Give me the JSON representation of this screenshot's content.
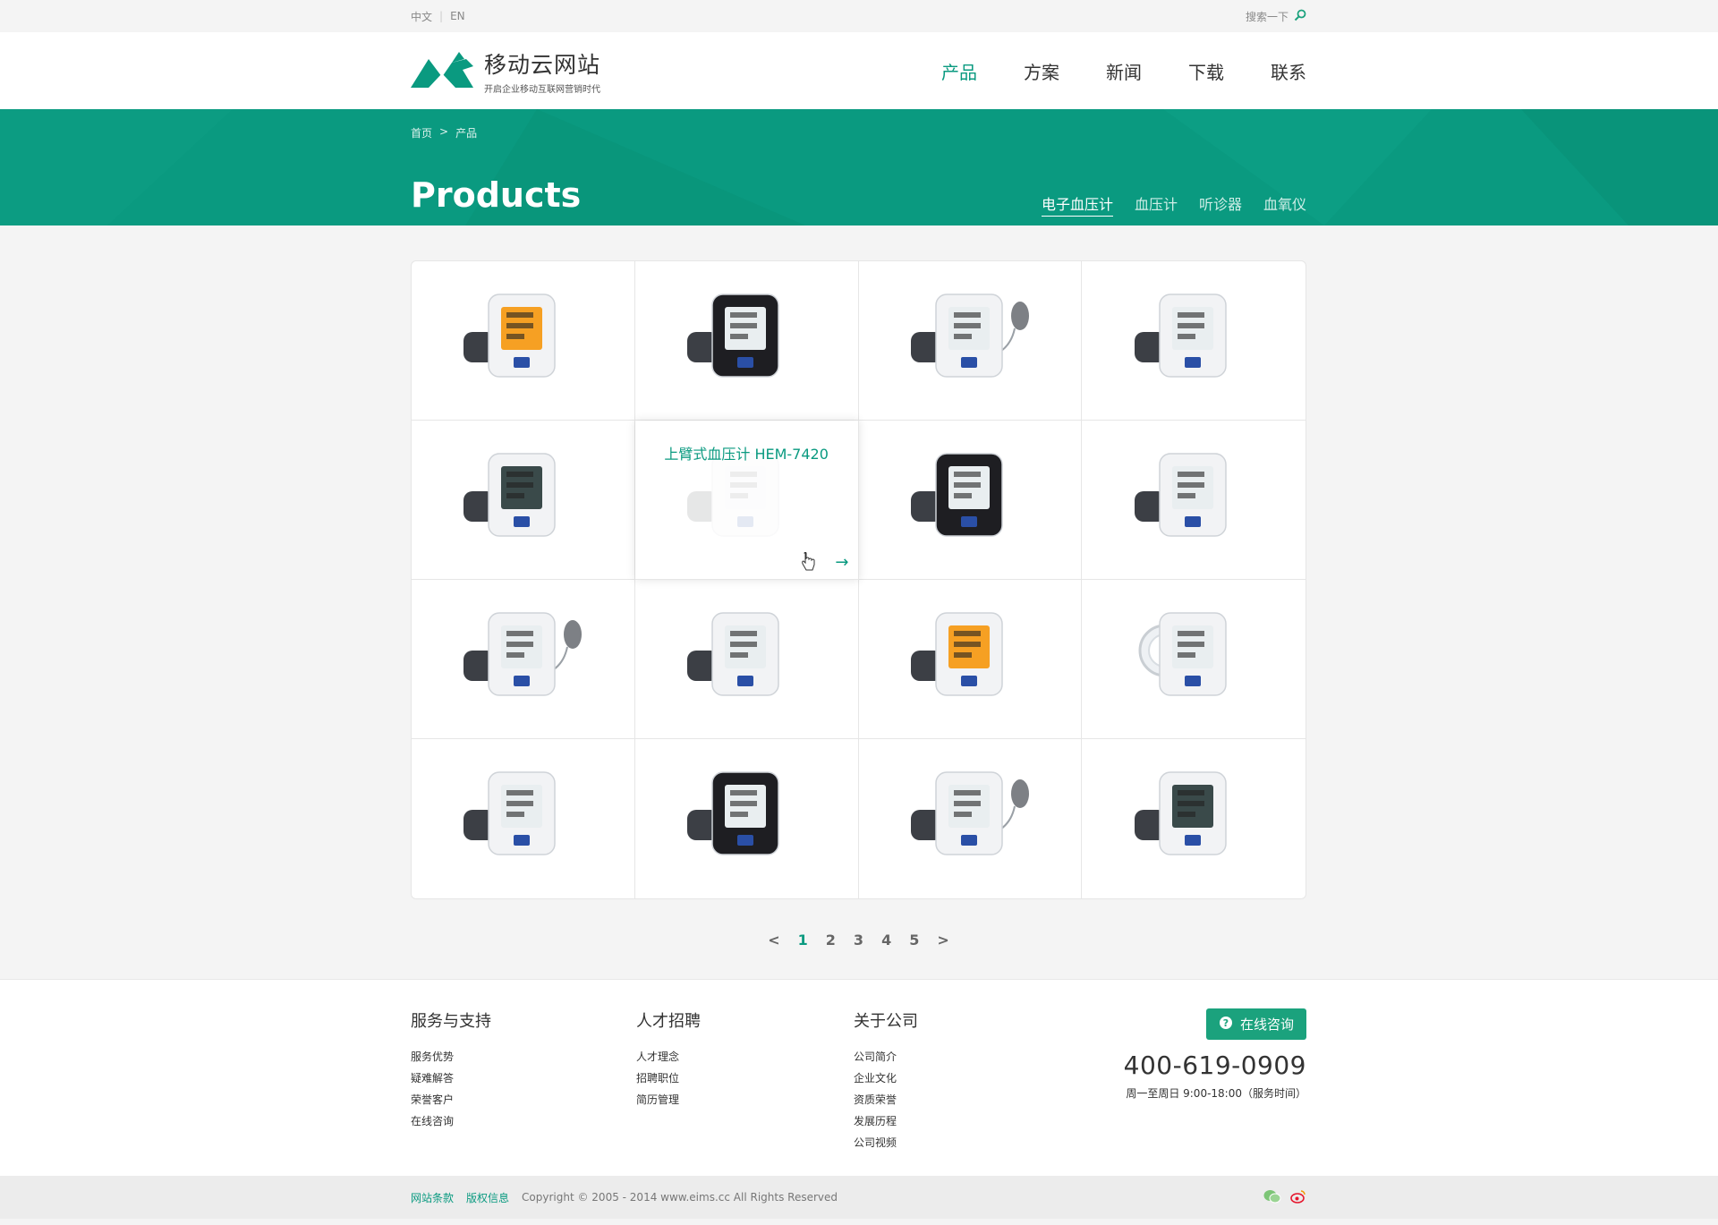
{
  "topbar": {
    "lang_cn": "中文",
    "lang_sep": "|",
    "lang_en": "EN",
    "search_label": "搜索一下"
  },
  "header": {
    "logo_name": "移动云网站",
    "logo_slogan": "开启企业移动互联网营销时代",
    "nav": [
      "产品",
      "方案",
      "新闻",
      "下载",
      "联系"
    ],
    "nav_active": 0,
    "accent_color": "#0a9a80"
  },
  "banner": {
    "breadcrumb": [
      "首页",
      ">",
      "产品"
    ],
    "title": "Products",
    "subnav": [
      "电子血压计",
      "血压计",
      "听诊器",
      "血氧仪"
    ],
    "subnav_active": 0
  },
  "products": {
    "hover_index": 5,
    "hover_title": "上臂式血压计 HEM-7420",
    "hover_arrow": "→",
    "items": [
      {
        "screen": "orange",
        "style": "white"
      },
      {
        "screen": "white",
        "style": "black"
      },
      {
        "screen": "white",
        "style": "bulb"
      },
      {
        "screen": "white",
        "style": "white"
      },
      {
        "screen": "dark",
        "style": "white"
      },
      {
        "screen": "white",
        "style": "white"
      },
      {
        "screen": "white",
        "style": "black"
      },
      {
        "screen": "white",
        "style": "white"
      },
      {
        "screen": "white",
        "style": "bulb"
      },
      {
        "screen": "white",
        "style": "white"
      },
      {
        "screen": "orange",
        "style": "white"
      },
      {
        "screen": "white",
        "style": "arm"
      },
      {
        "screen": "white",
        "style": "white"
      },
      {
        "screen": "white",
        "style": "black"
      },
      {
        "screen": "white",
        "style": "bulb"
      },
      {
        "screen": "dark",
        "style": "white"
      }
    ]
  },
  "pager": {
    "prev": "<",
    "pages": [
      "1",
      "2",
      "3",
      "4",
      "5"
    ],
    "active": 0,
    "next": ">"
  },
  "footer": {
    "columns": [
      {
        "title": "服务与支持",
        "links": [
          "服务优势",
          "疑难解答",
          "荣誉客户",
          "在线咨询"
        ]
      },
      {
        "title": "人才招聘",
        "links": [
          "人才理念",
          "招聘职位",
          "简历管理"
        ]
      },
      {
        "title": "关于公司",
        "links": [
          "公司简介",
          "企业文化",
          "资质荣誉",
          "发展历程",
          "公司视频"
        ]
      }
    ],
    "consult_label": "在线咨询",
    "phone": "400-619-0909",
    "hours": "周一至周日 9:00-18:00（服务时间）"
  },
  "bottom": {
    "link1": "网站条款",
    "link2": "版权信息",
    "copyright": "Copyright © 2005 - 2014 www.eims.cc All Rights Reserved"
  }
}
